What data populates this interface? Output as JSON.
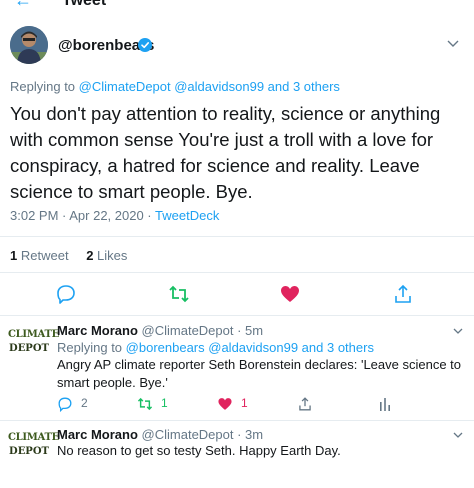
{
  "header": {
    "title": "Tweet"
  },
  "tweet": {
    "handle": "@borenbears",
    "replying_prefix": "Replying to",
    "replying_links": "@ClimateDepot @aldavidson99 and 3 others",
    "text": "You don't pay attention to reality, science or anything with common sense You're just a troll with a love for conspiracy, a hatred for science and reality. Leave science to smart people. Bye.",
    "time": "3:02 PM · Apr 22, 2020 · ",
    "client": "TweetDeck",
    "retweets_count": "1",
    "retweets_label": "Retweet",
    "likes_count": "2",
    "likes_label": "Likes"
  },
  "replies": [
    {
      "logo_line1": "CLIMATE",
      "logo_line2": "DEPOT",
      "name": "Marc Morano",
      "handle_time": "@ClimateDepot · 5m",
      "replying_prefix": "Replying to",
      "replying_links": "@borenbears @aldavidson99 and 3 others",
      "text": "Angry AP climate reporter Seth Borenstein declares: 'Leave science to smart people. Bye.'",
      "reply_count": "2",
      "retweet_count": "1",
      "like_count": "1"
    },
    {
      "logo_line1": "CLIMATE",
      "logo_line2": "DEPOT",
      "name": "Marc Morano",
      "handle_time": "@ClimateDepot · 3m",
      "text": "No reason to get so testy Seth. Happy Earth Day."
    }
  ],
  "colors": {
    "accent": "#1da1f2",
    "retweet": "#17bf63",
    "like": "#e0245e",
    "muted": "#657786"
  }
}
